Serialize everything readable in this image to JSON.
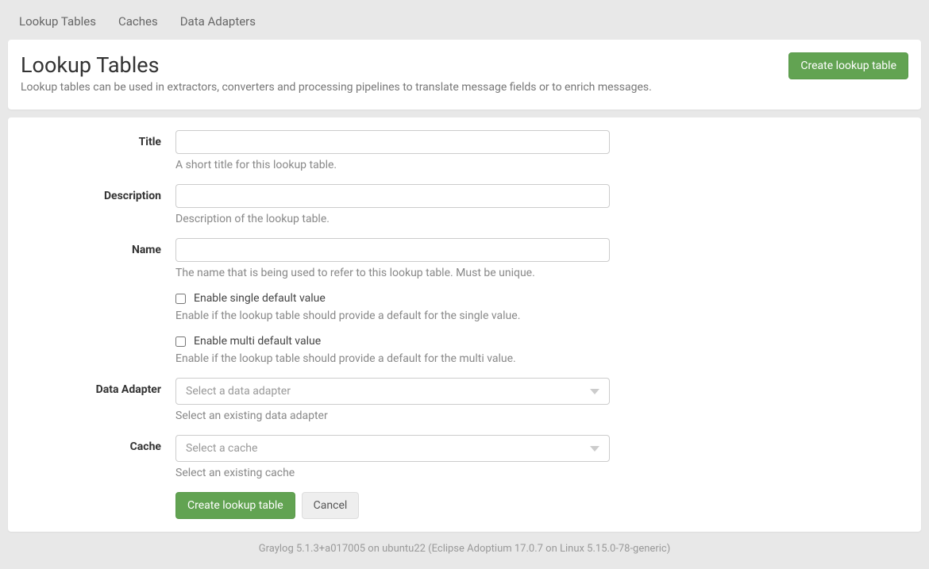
{
  "tabs": {
    "lookup_tables": "Lookup Tables",
    "caches": "Caches",
    "data_adapters": "Data Adapters"
  },
  "header": {
    "title": "Lookup Tables",
    "subtitle": "Lookup tables can be used in extractors, converters and processing pipelines to translate message fields or to enrich messages.",
    "create_button": "Create lookup table"
  },
  "form": {
    "title": {
      "label": "Title",
      "value": "",
      "help": "A short title for this lookup table."
    },
    "description": {
      "label": "Description",
      "value": "",
      "help": "Description of the lookup table."
    },
    "name": {
      "label": "Name",
      "value": "",
      "help": "The name that is being used to refer to this lookup table. Must be unique."
    },
    "enable_single": {
      "label": "Enable single default value",
      "help": "Enable if the lookup table should provide a default for the single value."
    },
    "enable_multi": {
      "label": "Enable multi default value",
      "help": "Enable if the lookup table should provide a default for the multi value."
    },
    "data_adapter": {
      "label": "Data Adapter",
      "placeholder": "Select a data adapter",
      "help": "Select an existing data adapter"
    },
    "cache": {
      "label": "Cache",
      "placeholder": "Select a cache",
      "help": "Select an existing cache"
    },
    "submit": "Create lookup table",
    "cancel": "Cancel"
  },
  "footer": "Graylog 5.1.3+a017005 on ubuntu22 (Eclipse Adoptium 17.0.7 on Linux 5.15.0-78-generic)"
}
